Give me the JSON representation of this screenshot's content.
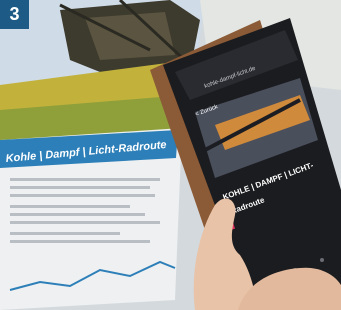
{
  "badge": {
    "number": "3"
  },
  "brochure": {
    "headline": "Kohle | Dampf | Licht-Radroute"
  },
  "phone": {
    "url": "kohle-dampf-licht.de",
    "back_label": "< Zurück",
    "route_title_line1": "KOHLE | DAMPF | LICHT-",
    "route_title_line2": "Radroute"
  },
  "colors": {
    "badge_bg": "#1d5b86",
    "brochure_banner": "#2c7fb8",
    "phone_body": "#1b1c1f",
    "phone_accent": "#e0325f",
    "sky": "#cfdbe6",
    "hand_skin": "#e8c3a8",
    "phone_case": "#8b5a36"
  },
  "icons": [
    "excavator-photo",
    "phone-menu-icon",
    "location-pin-icon"
  ]
}
